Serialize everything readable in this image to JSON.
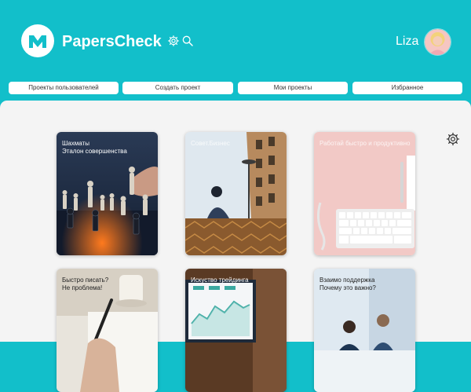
{
  "header": {
    "brand": "PapersCheck",
    "user_name": "Liza",
    "icons": [
      "logo-icon",
      "gear-icon",
      "search-icon",
      "avatar"
    ]
  },
  "nav": {
    "items": [
      {
        "label": "Проекты пользователей"
      },
      {
        "label": "Создать проект"
      },
      {
        "label": "Мои проекты"
      },
      {
        "label": "Избранное"
      }
    ]
  },
  "cards": [
    {
      "line1": "Шахматы",
      "line2": "Эталон совершенства"
    },
    {
      "line1": "Совет.Бизнес",
      "line2": ""
    },
    {
      "line1": "Работай быстро и продуктивно",
      "line2": ""
    },
    {
      "line1": "Быстро писать?",
      "line2": "Не проблема!"
    },
    {
      "line1": "Искуство трейдинга",
      "line2": ""
    },
    {
      "line1": "Взаимо поддержка",
      "line2": "Почему это важно?"
    }
  ],
  "colors": {
    "accent": "#12bfca",
    "content_bg": "#f4f4f4"
  }
}
